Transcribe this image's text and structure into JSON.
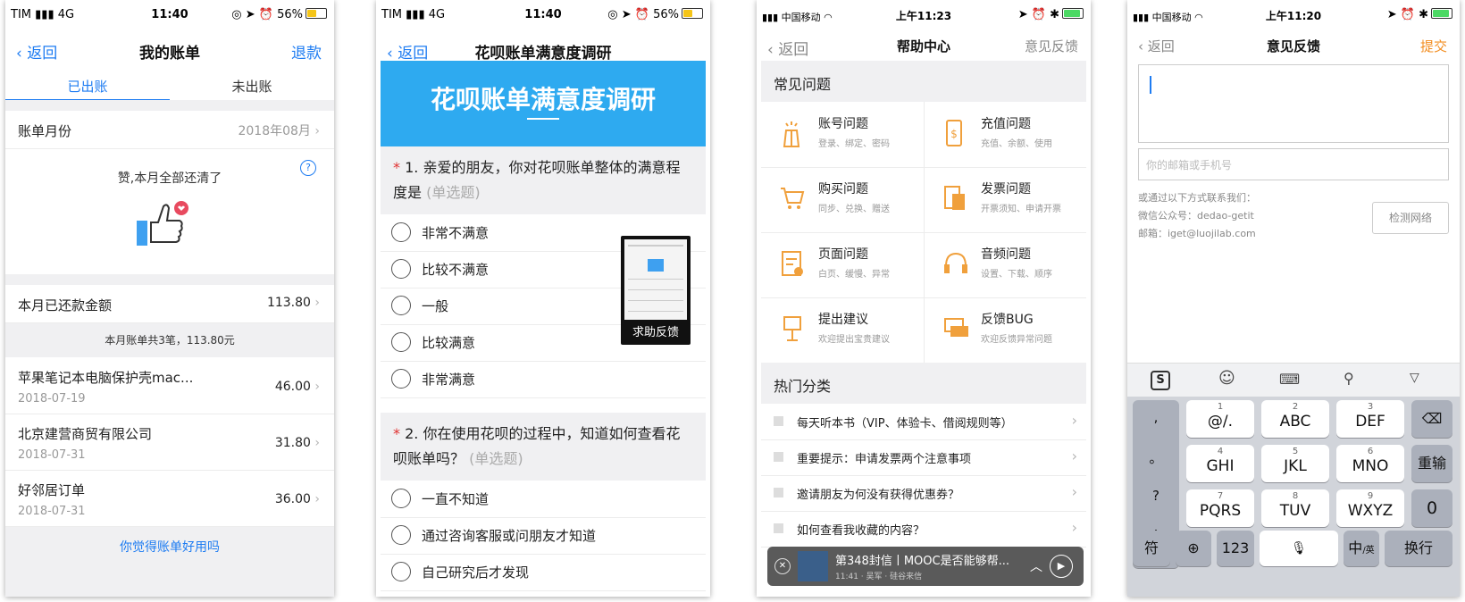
{
  "screen1": {
    "status": {
      "carrier": "TIM",
      "network": "4G",
      "time": "11:40",
      "battery": "56%"
    },
    "nav": {
      "back": "返回",
      "title": "我的账单",
      "action": "退款"
    },
    "tabs": [
      "已出账",
      "未出账"
    ],
    "bill_month": {
      "label": "账单月份",
      "value": "2018年08月"
    },
    "congrats": "赞,本月全部还清了",
    "repaid": {
      "label": "本月已还款金额",
      "value": "113.80"
    },
    "summary": "本月账单共3笔，113.80元",
    "items": [
      {
        "name": "苹果笔记本电脑保护壳mac...",
        "date": "2018-07-19",
        "amount": "46.00"
      },
      {
        "name": "北京建营商贸有限公司",
        "date": "2018-07-31",
        "amount": "31.80"
      },
      {
        "name": "好邻居订单",
        "date": "2018-07-31",
        "amount": "36.00"
      }
    ],
    "footer_link": "你觉得账单好用吗"
  },
  "screen2": {
    "status": {
      "carrier": "TIM",
      "network": "4G",
      "time": "11:40",
      "battery": "56%"
    },
    "nav": {
      "back": "返回",
      "title": "花呗账单满意度调研"
    },
    "banner": "花呗账单满意度调研",
    "q1": {
      "star": "*",
      "text": "1. 亲爱的朋友，你对花呗账单整体的满意程度是",
      "hint": "(单选题)"
    },
    "q1_options": [
      "非常不满意",
      "比较不满意",
      "一般",
      "比较满意",
      "非常满意"
    ],
    "q2": {
      "star": "*",
      "text": "2. 你在使用花呗的过程中，知道如何查看花呗账单吗？",
      "hint": "(单选题)"
    },
    "q2_options": [
      "一直不知道",
      "通过咨询客服或问朋友才知道",
      "自己研究后才发现"
    ],
    "help_float": "求助反馈"
  },
  "screen3": {
    "status": {
      "carrier": "中国移动",
      "time": "上午11:23"
    },
    "nav": {
      "back": "返回",
      "title": "帮助中心",
      "action": "意见反馈"
    },
    "faq_header": "常见问题",
    "faq": [
      {
        "title": "账号问题",
        "sub": "登录、绑定、密码",
        "icon": "account-icon"
      },
      {
        "title": "充值问题",
        "sub": "充值、余额、使用",
        "icon": "recharge-icon"
      },
      {
        "title": "购买问题",
        "sub": "同步、兑换、赠送",
        "icon": "cart-icon"
      },
      {
        "title": "发票问题",
        "sub": "开票须知、申请开票",
        "icon": "invoice-icon"
      },
      {
        "title": "页面问题",
        "sub": "白页、缓慢、异常",
        "icon": "page-icon"
      },
      {
        "title": "音频问题",
        "sub": "设置、下载、顺序",
        "icon": "headphones-icon"
      },
      {
        "title": "提出建议",
        "sub": "欢迎提出宝贵建议",
        "icon": "suggestion-icon"
      },
      {
        "title": "反馈BUG",
        "sub": "欢迎反馈异常问题",
        "icon": "bug-feedback-icon"
      }
    ],
    "hot_header": "热门分类",
    "hot": [
      "每天听本书（VIP、体验卡、借阅规则等）",
      "重要提示：申请发票两个注意事项",
      "邀请朋友为何没有获得优惠券？",
      "如何查看我收藏的内容？"
    ],
    "player": {
      "title": "第348封信丨MOOC是否能够帮...",
      "meta": "11:41 · 吴军 · 硅谷来信"
    }
  },
  "screen4": {
    "status": {
      "carrier": "中国移动",
      "time": "上午11:20"
    },
    "nav": {
      "back": "返回",
      "title": "意见反馈",
      "action": "提交"
    },
    "contact_placeholder": "你的邮箱或手机号",
    "contact_info": [
      "或通过以下方式联系我们：",
      "微信公众号：dedao-getit",
      "邮箱：iget@luojilab.com"
    ],
    "check_button": "检测网络",
    "keyboard": {
      "left": [
        ",",
        "。",
        "?",
        "!"
      ],
      "keys": [
        {
          "n": "1",
          "l": "@/."
        },
        {
          "n": "2",
          "l": "ABC"
        },
        {
          "n": "3",
          "l": "DEF"
        },
        {
          "n": "4",
          "l": "GHI"
        },
        {
          "n": "5",
          "l": "JKL"
        },
        {
          "n": "6",
          "l": "MNO"
        },
        {
          "n": "7",
          "l": "PQRS"
        },
        {
          "n": "8",
          "l": "TUV"
        },
        {
          "n": "9",
          "l": "WXYZ"
        }
      ],
      "reenter": "重输",
      "zero": "0",
      "bottom": {
        "sym": "符",
        "num": "123",
        "lang": "中",
        "lang_sub": "/英",
        "enter": "换行"
      }
    }
  },
  "colors": {
    "blue": "#1e7cf2",
    "banner": "#2eaaf0",
    "orange": "#f28c1e",
    "icon_orange": "#f0a03c"
  }
}
